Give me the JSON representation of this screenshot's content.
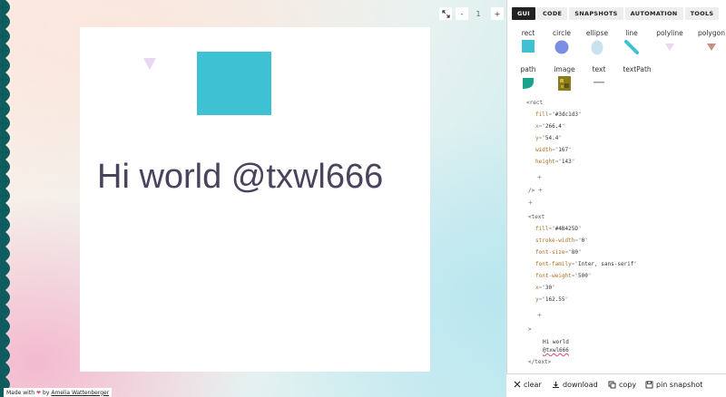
{
  "toolbar": {
    "expand_icon": "expand-icon",
    "zoom_out_label": "-",
    "zoom_level": "1",
    "zoom_in_label": "+"
  },
  "tabs": [
    {
      "label": "GUI",
      "active": true
    },
    {
      "label": "CODE",
      "active": false
    },
    {
      "label": "SNAPSHOTS",
      "active": false
    },
    {
      "label": "AUTOMATION",
      "active": false
    },
    {
      "label": "TOOLS",
      "active": false
    }
  ],
  "shapes": [
    {
      "label": "rect",
      "color": "#3dc1d3"
    },
    {
      "label": "circle",
      "color": "#7b8ee6"
    },
    {
      "label": "ellipse",
      "color": "#c9e3ee"
    },
    {
      "label": "line",
      "color": "#3dc1d3"
    },
    {
      "label": "polyline",
      "color": "#e9d8f3"
    },
    {
      "label": "polygon",
      "color": "#c98f86"
    },
    {
      "label": "path",
      "color": "#1aa38a"
    },
    {
      "label": "image",
      "color": "#8a7a1a"
    },
    {
      "label": "text",
      "color": "#999999"
    },
    {
      "label": "textPath",
      "color": "#ffffff"
    }
  ],
  "canvas": {
    "text": "Hi world @txwl666",
    "text_color": "#4B425D",
    "rect_color": "#3dc1d3",
    "triangle_color": "#ead7f2"
  },
  "code": {
    "rect_open": "<rect",
    "rect_attrs": [
      {
        "name": "fill",
        "value": "#3dc1d3"
      },
      {
        "name": "x",
        "value": "266.4"
      },
      {
        "name": "y",
        "value": "54.4"
      },
      {
        "name": "width",
        "value": "167"
      },
      {
        "name": "height",
        "value": "143"
      }
    ],
    "rect_close": "/>",
    "text_open": "<text",
    "text_attrs": [
      {
        "name": "fill",
        "value": "#4B425D"
      },
      {
        "name": "stroke-width",
        "value": "0"
      },
      {
        "name": "font-size",
        "value": "80"
      },
      {
        "name": "font-family",
        "value": "Inter, sans-serif"
      },
      {
        "name": "font-weight",
        "value": "500"
      },
      {
        "name": "x",
        "value": "30"
      },
      {
        "name": "y",
        "value": "162.55"
      }
    ],
    "text_close_bracket": ">",
    "text_content_line1": "Hi world",
    "text_content_line2": "@txwl666",
    "text_end": "</text>",
    "plus": "+"
  },
  "footer": {
    "clear_label": "clear",
    "download_label": "download",
    "copy_label": "copy",
    "pin_label": "pin snapshot"
  },
  "credit": {
    "made_with": "Made with",
    "by": "by",
    "author": "Amelia Wattenberger"
  },
  "colors": {
    "edge": "#0e5c5e",
    "accent": "#3dc1d3"
  }
}
